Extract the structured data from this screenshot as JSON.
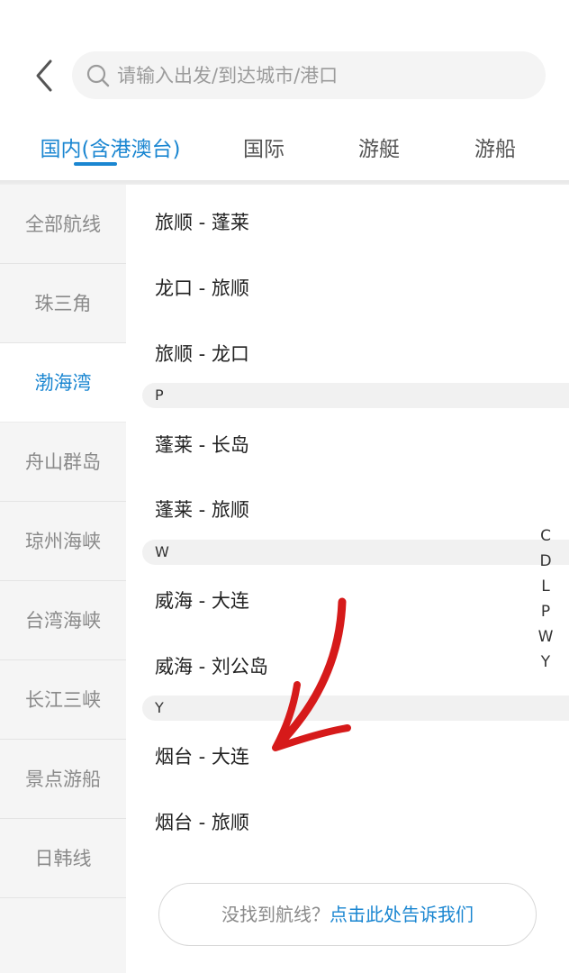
{
  "search": {
    "placeholder": "请输入出发/到达城市/港口"
  },
  "tabs": [
    {
      "label": "国内(含港澳台)",
      "active": true
    },
    {
      "label": "国际",
      "active": false
    },
    {
      "label": "游艇",
      "active": false
    },
    {
      "label": "游船",
      "active": false
    }
  ],
  "sidebar": {
    "items": [
      {
        "label": "全部航线",
        "active": false
      },
      {
        "label": "珠三角",
        "active": false
      },
      {
        "label": "渤海湾",
        "active": true
      },
      {
        "label": "舟山群岛",
        "active": false
      },
      {
        "label": "琼州海峡",
        "active": false
      },
      {
        "label": "台湾海峡",
        "active": false
      },
      {
        "label": "长江三峡",
        "active": false
      },
      {
        "label": "景点游船",
        "active": false
      },
      {
        "label": "日韩线",
        "active": false
      }
    ]
  },
  "routes": {
    "r0": "旅顺 - 蓬莱",
    "r1": "龙口 - 旅顺",
    "r2": "旅顺 - 龙口",
    "gP": "P",
    "r3": "蓬莱 - 长岛",
    "r4": "蓬莱 - 旅顺",
    "gW": "W",
    "r5": "威海 - 大连",
    "r6": "威海 - 刘公岛",
    "gY": "Y",
    "r7": "烟台 - 大连",
    "r8": "烟台 - 旅顺"
  },
  "index_letters": [
    "C",
    "D",
    "L",
    "P",
    "W",
    "Y"
  ],
  "feedback": {
    "question": "没找到航线？",
    "link": "点击此处告诉我们"
  },
  "colors": {
    "accent": "#1a86d1",
    "annotation": "#d61a1a"
  }
}
